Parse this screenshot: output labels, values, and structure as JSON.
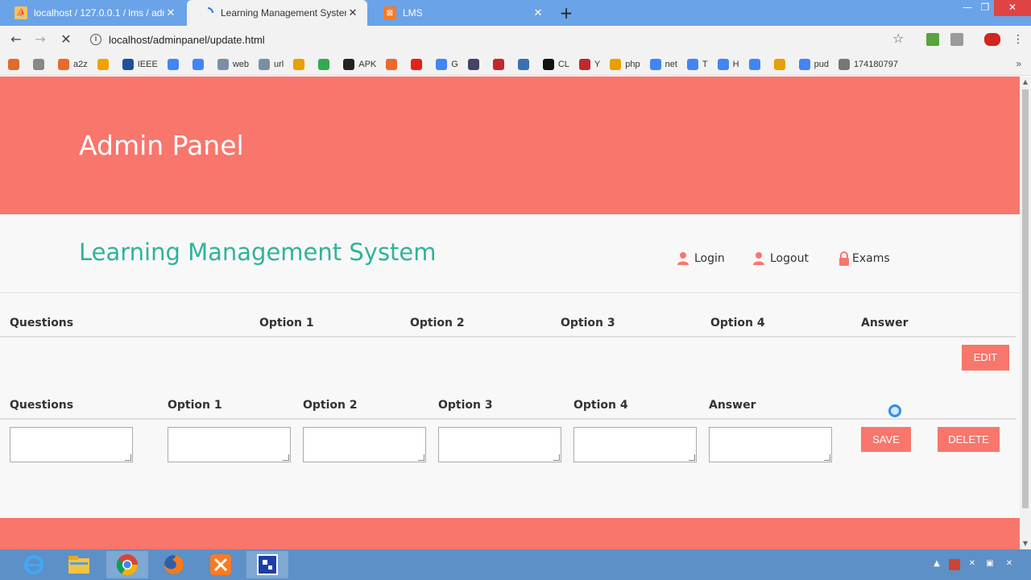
{
  "browser": {
    "tabs": [
      {
        "title": "localhost / 127.0.0.1 / lms / adm",
        "icon": "phpmyadmin-icon",
        "active": false
      },
      {
        "title": "Learning Management System",
        "icon": "loading-spinner-icon",
        "active": true
      },
      {
        "title": "LMS",
        "icon": "xampp-icon",
        "active": false
      }
    ],
    "new_tab_label": "+",
    "url": "localhost/adminpanel/update.html"
  },
  "bookmarks": [
    {
      "label": "",
      "color": "#e06c2a"
    },
    {
      "label": "",
      "color": "#888888"
    },
    {
      "label": "a2z",
      "color": "#e86a2c"
    },
    {
      "label": "",
      "color": "#f2a100"
    },
    {
      "label": "IEEE",
      "color": "#1f4e9c"
    },
    {
      "label": "",
      "color": "#4285f4"
    },
    {
      "label": "",
      "color": "#4285f4"
    },
    {
      "label": "web",
      "color": "#7a8fa6"
    },
    {
      "label": "url",
      "color": "#7a8fa6"
    },
    {
      "label": "",
      "color": "#e8a000"
    },
    {
      "label": "",
      "color": "#34a853"
    },
    {
      "label": "APK",
      "color": "#222222"
    },
    {
      "label": "",
      "color": "#e86a2c"
    },
    {
      "label": "",
      "color": "#e62117"
    },
    {
      "label": "G",
      "color": "#4285f4"
    },
    {
      "label": "",
      "color": "#444466"
    },
    {
      "label": "",
      "color": "#c0282d"
    },
    {
      "label": "",
      "color": "#3b6fb6"
    },
    {
      "label": "CL",
      "color": "#111111"
    },
    {
      "label": "Y",
      "color": "#c0282d"
    },
    {
      "label": "php",
      "color": "#e8a000"
    },
    {
      "label": "net",
      "color": "#4285f4"
    },
    {
      "label": "T",
      "color": "#4285f4"
    },
    {
      "label": "H",
      "color": "#4285f4"
    },
    {
      "label": "",
      "color": "#4285f4"
    },
    {
      "label": "",
      "color": "#e8a000"
    },
    {
      "label": "pud",
      "color": "#4285f4"
    },
    {
      "label": "174180797",
      "color": "#777777"
    }
  ],
  "bookmarks_more": "»",
  "header": {
    "banner_title": "Admin Panel",
    "site_title": "Learning Management System",
    "nav": [
      {
        "label": "Login",
        "icon": "user-icon"
      },
      {
        "label": "Logout",
        "icon": "user-icon"
      },
      {
        "label": "Exams",
        "icon": "lock-icon"
      }
    ]
  },
  "table1": {
    "columns": [
      "Questions",
      "Option 1",
      "Option 2",
      "Option 3",
      "Option 4",
      "Answer"
    ],
    "edit_label": "EDIT"
  },
  "table2": {
    "columns": [
      "Questions",
      "Option 1",
      "Option 2",
      "Option 3",
      "Option 4",
      "Answer"
    ],
    "save_label": "SAVE",
    "delete_label": "DELETE"
  },
  "colors": {
    "accent": "#f8766c",
    "site_title": "#2fb39b",
    "taskbar": "#5c90c7",
    "tabstrip": "#6aa3e7"
  },
  "taskbar": {
    "apps": [
      "internet-explorer-icon",
      "file-explorer-icon",
      "chrome-icon",
      "firefox-icon",
      "xampp-icon",
      "app-icon"
    ]
  }
}
